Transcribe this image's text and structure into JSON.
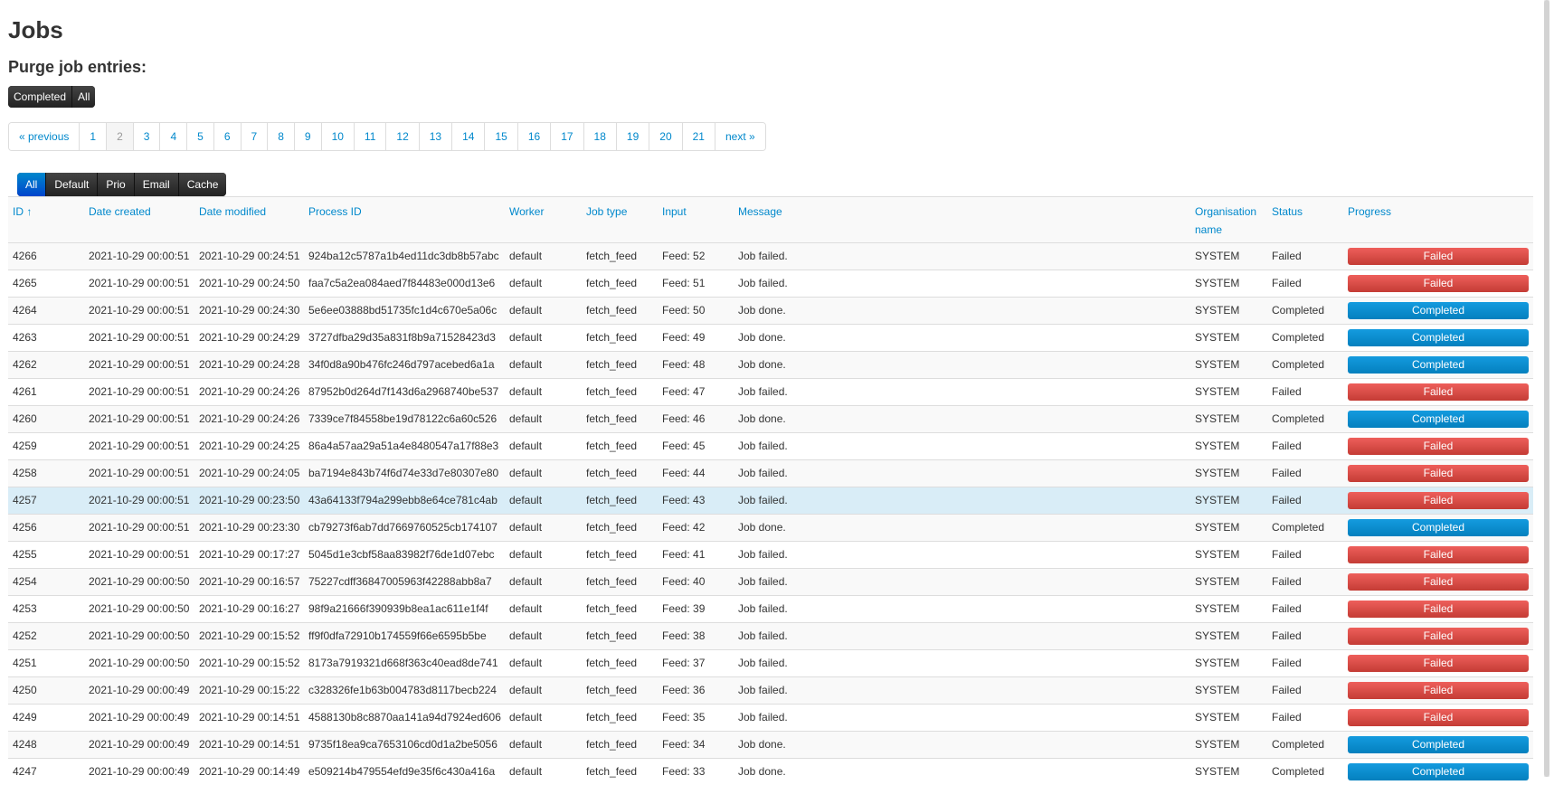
{
  "page": {
    "title": "Jobs",
    "purge_heading": "Purge job entries:"
  },
  "purge_buttons": [
    "Completed",
    "All"
  ],
  "pagination": {
    "previous": "« previous",
    "next": "next »",
    "pages": [
      "1",
      "2",
      "3",
      "4",
      "5",
      "6",
      "7",
      "8",
      "9",
      "10",
      "11",
      "12",
      "13",
      "14",
      "15",
      "16",
      "17",
      "18",
      "19",
      "20",
      "21"
    ],
    "current": "2"
  },
  "filters": {
    "items": [
      "All",
      "Default",
      "Prio",
      "Email",
      "Cache"
    ],
    "active": "All"
  },
  "table": {
    "headers": [
      "ID ↑",
      "Date created",
      "Date modified",
      "Process ID",
      "Worker",
      "Job type",
      "Input",
      "Message",
      "Organisation name",
      "Status",
      "Progress"
    ],
    "rows": [
      {
        "id": "4266",
        "created": "2021-10-29 00:00:51",
        "modified": "2021-10-29 00:24:51",
        "process": "924ba12c5787a1b4ed11dc3db8b57abc",
        "worker": "default",
        "type": "fetch_feed",
        "input": "Feed: 52",
        "message": "Job failed.",
        "org": "SYSTEM",
        "status": "Failed",
        "progress": "Failed"
      },
      {
        "id": "4265",
        "created": "2021-10-29 00:00:51",
        "modified": "2021-10-29 00:24:50",
        "process": "faa7c5a2ea084aed7f84483e000d13e6",
        "worker": "default",
        "type": "fetch_feed",
        "input": "Feed: 51",
        "message": "Job failed.",
        "org": "SYSTEM",
        "status": "Failed",
        "progress": "Failed"
      },
      {
        "id": "4264",
        "created": "2021-10-29 00:00:51",
        "modified": "2021-10-29 00:24:30",
        "process": "5e6ee03888bd51735fc1d4c670e5a06c",
        "worker": "default",
        "type": "fetch_feed",
        "input": "Feed: 50",
        "message": "Job done.",
        "org": "SYSTEM",
        "status": "Completed",
        "progress": "Completed"
      },
      {
        "id": "4263",
        "created": "2021-10-29 00:00:51",
        "modified": "2021-10-29 00:24:29",
        "process": "3727dfba29d35a831f8b9a71528423d3",
        "worker": "default",
        "type": "fetch_feed",
        "input": "Feed: 49",
        "message": "Job done.",
        "org": "SYSTEM",
        "status": "Completed",
        "progress": "Completed"
      },
      {
        "id": "4262",
        "created": "2021-10-29 00:00:51",
        "modified": "2021-10-29 00:24:28",
        "process": "34f0d8a90b476fc246d797acebed6a1a",
        "worker": "default",
        "type": "fetch_feed",
        "input": "Feed: 48",
        "message": "Job done.",
        "org": "SYSTEM",
        "status": "Completed",
        "progress": "Completed"
      },
      {
        "id": "4261",
        "created": "2021-10-29 00:00:51",
        "modified": "2021-10-29 00:24:26",
        "process": "87952b0d264d7f143d6a2968740be537",
        "worker": "default",
        "type": "fetch_feed",
        "input": "Feed: 47",
        "message": "Job failed.",
        "org": "SYSTEM",
        "status": "Failed",
        "progress": "Failed"
      },
      {
        "id": "4260",
        "created": "2021-10-29 00:00:51",
        "modified": "2021-10-29 00:24:26",
        "process": "7339ce7f84558be19d78122c6a60c526",
        "worker": "default",
        "type": "fetch_feed",
        "input": "Feed: 46",
        "message": "Job done.",
        "org": "SYSTEM",
        "status": "Completed",
        "progress": "Completed"
      },
      {
        "id": "4259",
        "created": "2021-10-29 00:00:51",
        "modified": "2021-10-29 00:24:25",
        "process": "86a4a57aa29a51a4e8480547a17f88e3",
        "worker": "default",
        "type": "fetch_feed",
        "input": "Feed: 45",
        "message": "Job failed.",
        "org": "SYSTEM",
        "status": "Failed",
        "progress": "Failed"
      },
      {
        "id": "4258",
        "created": "2021-10-29 00:00:51",
        "modified": "2021-10-29 00:24:05",
        "process": "ba7194e843b74f6d74e33d7e80307e80",
        "worker": "default",
        "type": "fetch_feed",
        "input": "Feed: 44",
        "message": "Job failed.",
        "org": "SYSTEM",
        "status": "Failed",
        "progress": "Failed"
      },
      {
        "id": "4257",
        "created": "2021-10-29 00:00:51",
        "modified": "2021-10-29 00:23:50",
        "process": "43a64133f794a299ebb8e64ce781c4ab",
        "worker": "default",
        "type": "fetch_feed",
        "input": "Feed: 43",
        "message": "Job failed.",
        "org": "SYSTEM",
        "status": "Failed",
        "progress": "Failed",
        "highlight": true
      },
      {
        "id": "4256",
        "created": "2021-10-29 00:00:51",
        "modified": "2021-10-29 00:23:30",
        "process": "cb79273f6ab7dd7669760525cb174107",
        "worker": "default",
        "type": "fetch_feed",
        "input": "Feed: 42",
        "message": "Job done.",
        "org": "SYSTEM",
        "status": "Completed",
        "progress": "Completed"
      },
      {
        "id": "4255",
        "created": "2021-10-29 00:00:51",
        "modified": "2021-10-29 00:17:27",
        "process": "5045d1e3cbf58aa83982f76de1d07ebc",
        "worker": "default",
        "type": "fetch_feed",
        "input": "Feed: 41",
        "message": "Job failed.",
        "org": "SYSTEM",
        "status": "Failed",
        "progress": "Failed"
      },
      {
        "id": "4254",
        "created": "2021-10-29 00:00:50",
        "modified": "2021-10-29 00:16:57",
        "process": "75227cdff36847005963f42288abb8a7",
        "worker": "default",
        "type": "fetch_feed",
        "input": "Feed: 40",
        "message": "Job failed.",
        "org": "SYSTEM",
        "status": "Failed",
        "progress": "Failed"
      },
      {
        "id": "4253",
        "created": "2021-10-29 00:00:50",
        "modified": "2021-10-29 00:16:27",
        "process": "98f9a21666f390939b8ea1ac611e1f4f",
        "worker": "default",
        "type": "fetch_feed",
        "input": "Feed: 39",
        "message": "Job failed.",
        "org": "SYSTEM",
        "status": "Failed",
        "progress": "Failed"
      },
      {
        "id": "4252",
        "created": "2021-10-29 00:00:50",
        "modified": "2021-10-29 00:15:52",
        "process": "ff9f0dfa72910b174559f66e6595b5be",
        "worker": "default",
        "type": "fetch_feed",
        "input": "Feed: 38",
        "message": "Job failed.",
        "org": "SYSTEM",
        "status": "Failed",
        "progress": "Failed"
      },
      {
        "id": "4251",
        "created": "2021-10-29 00:00:50",
        "modified": "2021-10-29 00:15:52",
        "process": "8173a7919321d668f363c40ead8de741",
        "worker": "default",
        "type": "fetch_feed",
        "input": "Feed: 37",
        "message": "Job failed.",
        "org": "SYSTEM",
        "status": "Failed",
        "progress": "Failed"
      },
      {
        "id": "4250",
        "created": "2021-10-29 00:00:49",
        "modified": "2021-10-29 00:15:22",
        "process": "c328326fe1b63b004783d8117becb224",
        "worker": "default",
        "type": "fetch_feed",
        "input": "Feed: 36",
        "message": "Job failed.",
        "org": "SYSTEM",
        "status": "Failed",
        "progress": "Failed"
      },
      {
        "id": "4249",
        "created": "2021-10-29 00:00:49",
        "modified": "2021-10-29 00:14:51",
        "process": "4588130b8c8870aa141a94d7924ed606",
        "worker": "default",
        "type": "fetch_feed",
        "input": "Feed: 35",
        "message": "Job failed.",
        "org": "SYSTEM",
        "status": "Failed",
        "progress": "Failed"
      },
      {
        "id": "4248",
        "created": "2021-10-29 00:00:49",
        "modified": "2021-10-29 00:14:51",
        "process": "9735f18ea9ca7653106cd0d1a2be5056",
        "worker": "default",
        "type": "fetch_feed",
        "input": "Feed: 34",
        "message": "Job done.",
        "org": "SYSTEM",
        "status": "Completed",
        "progress": "Completed"
      },
      {
        "id": "4247",
        "created": "2021-10-29 00:00:49",
        "modified": "2021-10-29 00:14:49",
        "process": "e509214b479554efd9e35f6c430a416a",
        "worker": "default",
        "type": "fetch_feed",
        "input": "Feed: 33",
        "message": "Job done.",
        "org": "SYSTEM",
        "status": "Completed",
        "progress": "Completed"
      }
    ]
  },
  "colors": {
    "link": "#0088cc",
    "failed": "#c43c35",
    "completed": "#0480be",
    "highlight": "#d9edf7"
  }
}
